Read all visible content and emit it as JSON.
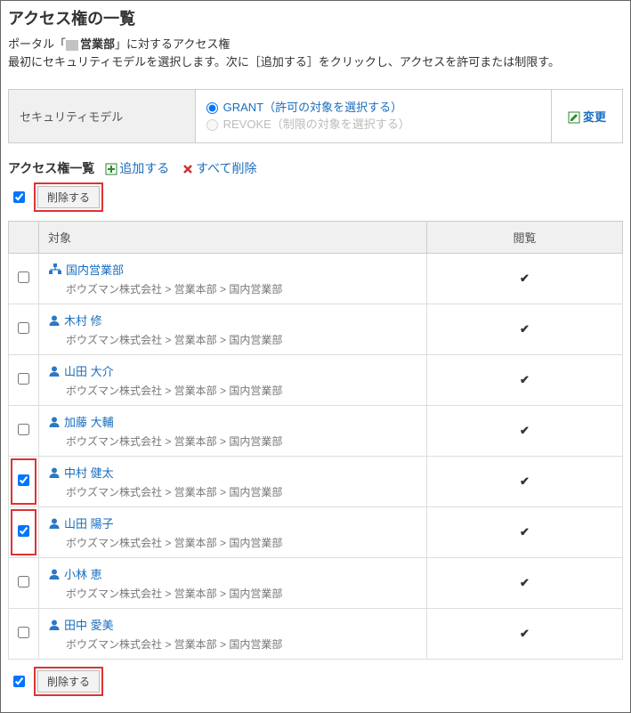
{
  "page_title": "アクセス権の一覧",
  "intro": {
    "prefix": "ポータル「",
    "portal_name": "営業部",
    "suffix": "」に対するアクセス権"
  },
  "instruction": "最初にセキュリティモデルを選択します。次に［追加する］をクリックし、アクセスを許可または制限す。",
  "security_model": {
    "label": "セキュリティモデル",
    "grant": "GRANT（許可の対象を選択する）",
    "revoke": "REVOKE（制限の対象を選択する）",
    "change": "変更"
  },
  "list_header": "アクセス権一覧",
  "actions": {
    "add": "追加する",
    "delete_all": "すべて削除",
    "delete": "削除する"
  },
  "columns": {
    "target": "対象",
    "view": "閲覧"
  },
  "rows": [
    {
      "type": "org",
      "name": "国内営業部",
      "path": "ボウズマン株式会社 > 営業本部 > 国内営業部",
      "checked": false,
      "hl": false
    },
    {
      "type": "user",
      "name": "木村 修",
      "path": "ボウズマン株式会社 > 営業本部 > 国内営業部",
      "checked": false,
      "hl": false
    },
    {
      "type": "user",
      "name": "山田 大介",
      "path": "ボウズマン株式会社 > 営業本部 > 国内営業部",
      "checked": false,
      "hl": false
    },
    {
      "type": "user",
      "name": "加藤 大輔",
      "path": "ボウズマン株式会社 > 営業本部 > 国内営業部",
      "checked": false,
      "hl": false
    },
    {
      "type": "user",
      "name": "中村 健太",
      "path": "ボウズマン株式会社 > 営業本部 > 国内営業部",
      "checked": true,
      "hl": true
    },
    {
      "type": "user",
      "name": "山田 陽子",
      "path": "ボウズマン株式会社 > 営業本部 > 国内営業部",
      "checked": true,
      "hl": true
    },
    {
      "type": "user",
      "name": "小林 恵",
      "path": "ボウズマン株式会社 > 営業本部 > 国内営業部",
      "checked": false,
      "hl": false
    },
    {
      "type": "user",
      "name": "田中 愛美",
      "path": "ボウズマン株式会社 > 営業本部 > 国内営業部",
      "checked": false,
      "hl": false
    }
  ]
}
